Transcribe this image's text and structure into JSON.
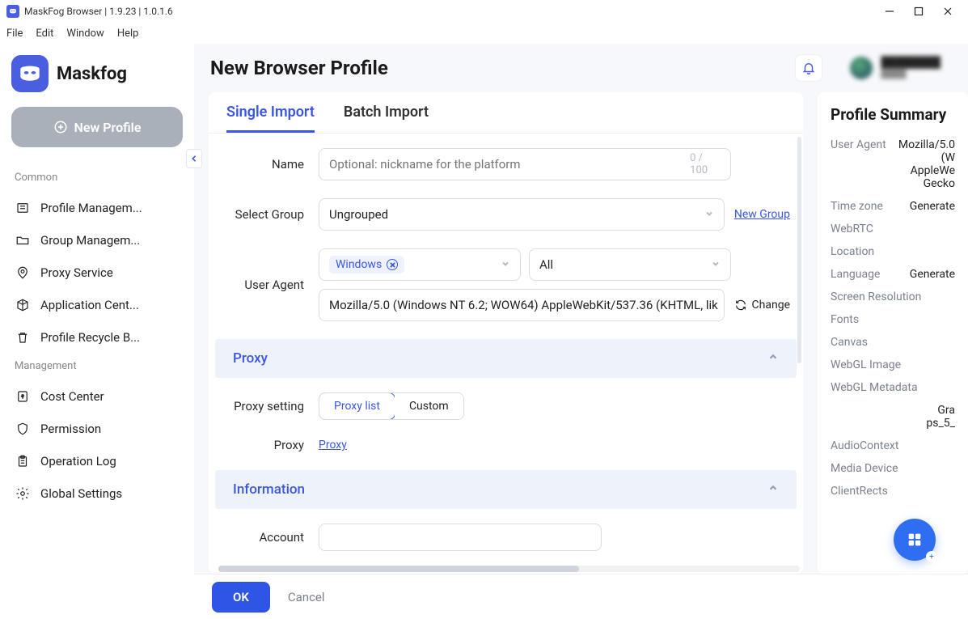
{
  "window": {
    "title": "MaskFog Browser | 1.9.23 | 1.0.1.6"
  },
  "menubar": {
    "items": [
      "File",
      "Edit",
      "Window",
      "Help"
    ]
  },
  "brand": {
    "name": "Maskfog"
  },
  "sidebar": {
    "new_profile_label": "New Profile",
    "sections": {
      "common": {
        "title": "Common",
        "items": [
          {
            "label": "Profile Managem..."
          },
          {
            "label": "Group Managem..."
          },
          {
            "label": "Proxy Service"
          },
          {
            "label": "Application Cent..."
          },
          {
            "label": "Profile Recycle B..."
          }
        ]
      },
      "management": {
        "title": "Management",
        "items": [
          {
            "label": "Cost Center"
          },
          {
            "label": "Permission"
          },
          {
            "label": "Operation Log"
          },
          {
            "label": "Global Settings"
          }
        ]
      }
    }
  },
  "header": {
    "title": "New Browser Profile"
  },
  "tabs": {
    "single": "Single Import",
    "batch": "Batch Import"
  },
  "form": {
    "name_label": "Name",
    "name_placeholder": "Optional: nickname for the platform",
    "name_counter": "0 / 100",
    "group_label": "Select Group",
    "group_value": "Ungrouped",
    "new_group_link": "New Group",
    "ua_label": "User Agent",
    "ua_os_tag": "Windows",
    "ua_ver_value": "All",
    "ua_string": "Mozilla/5.0 (Windows NT 6.2; WOW64) AppleWebKit/537.36 (KHTML, lik",
    "change_label": "Change",
    "proxy_section": "Proxy",
    "proxy_setting_label": "Proxy setting",
    "proxy_setting_options": {
      "list": "Proxy list",
      "custom": "Custom"
    },
    "proxy_label": "Proxy",
    "proxy_link": "Proxy",
    "info_section": "Information",
    "account_label": "Account"
  },
  "summary": {
    "title": "Profile Summary",
    "rows": {
      "user_agent": {
        "label": "User Agent",
        "value": "Mozilla/5.0 (W\nAppleWe\nGecko"
      },
      "time_zone": {
        "label": "Time zone",
        "value": "Generate"
      },
      "webrtc": {
        "label": "WebRTC",
        "value": ""
      },
      "location": {
        "label": "Location",
        "value": ""
      },
      "language": {
        "label": "Language",
        "value": "Generate"
      },
      "screen_res": {
        "label": "Screen Resolution",
        "value": ""
      },
      "fonts": {
        "label": "Fonts",
        "value": ""
      },
      "canvas": {
        "label": "Canvas",
        "value": ""
      },
      "webgl_image": {
        "label": "WebGL Image",
        "value": ""
      },
      "webgl_meta": {
        "label": "WebGL Metadata",
        "value": ""
      },
      "extra1": {
        "label": "",
        "value": "Gra\nps_5_"
      },
      "audio": {
        "label": "AudioContext",
        "value": ""
      },
      "media": {
        "label": "Media Device",
        "value": ""
      },
      "client_rects": {
        "label": "ClientRects",
        "value": ""
      }
    }
  },
  "footer": {
    "ok": "OK",
    "cancel": "Cancel"
  }
}
